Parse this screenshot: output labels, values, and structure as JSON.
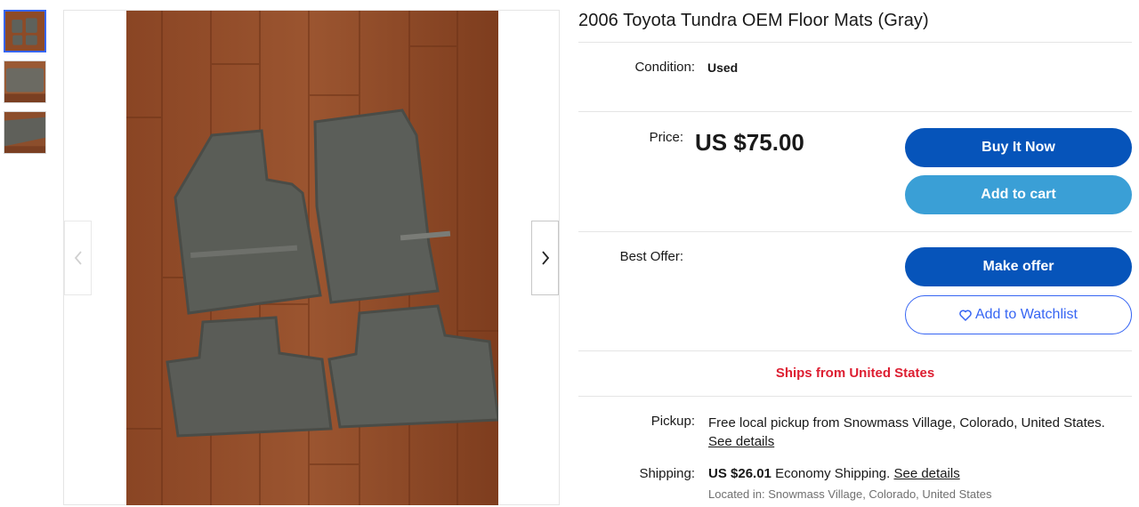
{
  "listing": {
    "title": "2006 Toyota Tundra OEM Floor Mats (Gray)",
    "condition_label": "Condition:",
    "condition_value": "Used",
    "price_label": "Price:",
    "price_value": "US $75.00",
    "best_offer_label": "Best Offer:",
    "ships_from": "Ships from United States"
  },
  "buttons": {
    "buy_now": "Buy It Now",
    "add_to_cart": "Add to cart",
    "make_offer": "Make offer",
    "add_to_watchlist": "Add to Watchlist"
  },
  "pickup": {
    "label": "Pickup:",
    "text": "Free local pickup from Snowmass Village, Colorado, United States.",
    "link": "See details"
  },
  "shipping": {
    "label": "Shipping:",
    "cost": "US $26.01",
    "method": "Economy Shipping.",
    "link": "See details",
    "located": "Located in: Snowmass Village, Colorado, United States"
  },
  "gallery": {
    "thumbnail_count": 3,
    "active_thumbnail": 1,
    "icons": [
      "chevron-left-icon",
      "chevron-right-icon",
      "heart-icon"
    ]
  },
  "colors": {
    "primary_button": "#0654ba",
    "secondary_button": "#3a9fd6",
    "link_blue": "#3665f3",
    "ships_red": "#dd1e31",
    "floor_wood": "#8a4a28",
    "mat_gray": "#5b5e58"
  }
}
